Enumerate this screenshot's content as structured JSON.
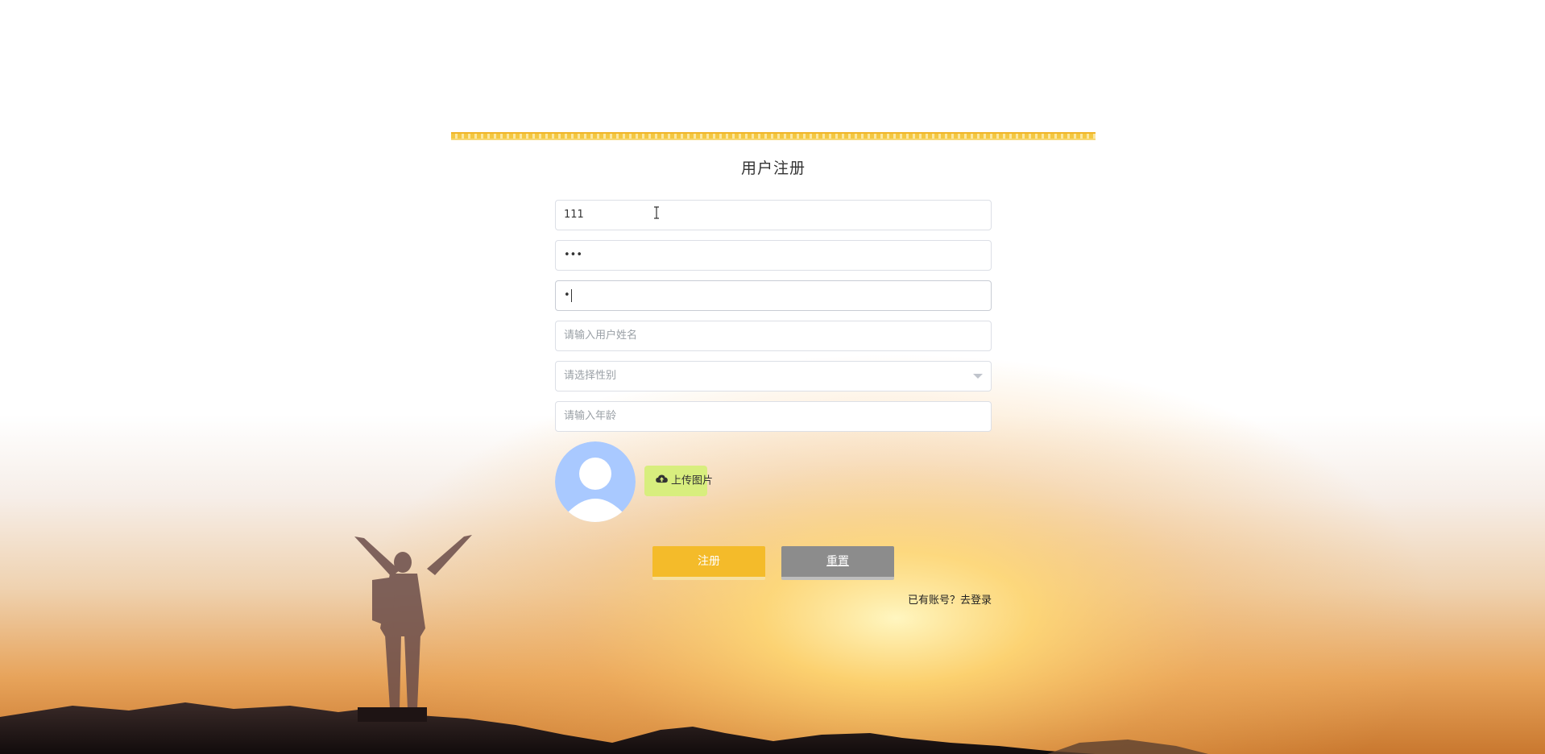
{
  "form": {
    "title": "用户注册",
    "username_value": "111",
    "password_value": "•••",
    "confirm_password_value": "•",
    "name_placeholder": "请输入用户姓名",
    "gender_placeholder": "请选择性别",
    "age_placeholder": "请输入年龄",
    "upload_label": "上传图片",
    "register_label": "注册",
    "reset_label": "重置",
    "login_prompt": "已有账号？去登录"
  },
  "icons": {
    "avatar": "default-avatar-icon",
    "upload": "cloud-upload-icon",
    "select": "chevron-down-icon"
  },
  "colors": {
    "accent": "#f4bb2a",
    "upload_button": "#d8ee7e",
    "reset_button": "#8c8c8c",
    "avatar": "#a9c9ff"
  }
}
